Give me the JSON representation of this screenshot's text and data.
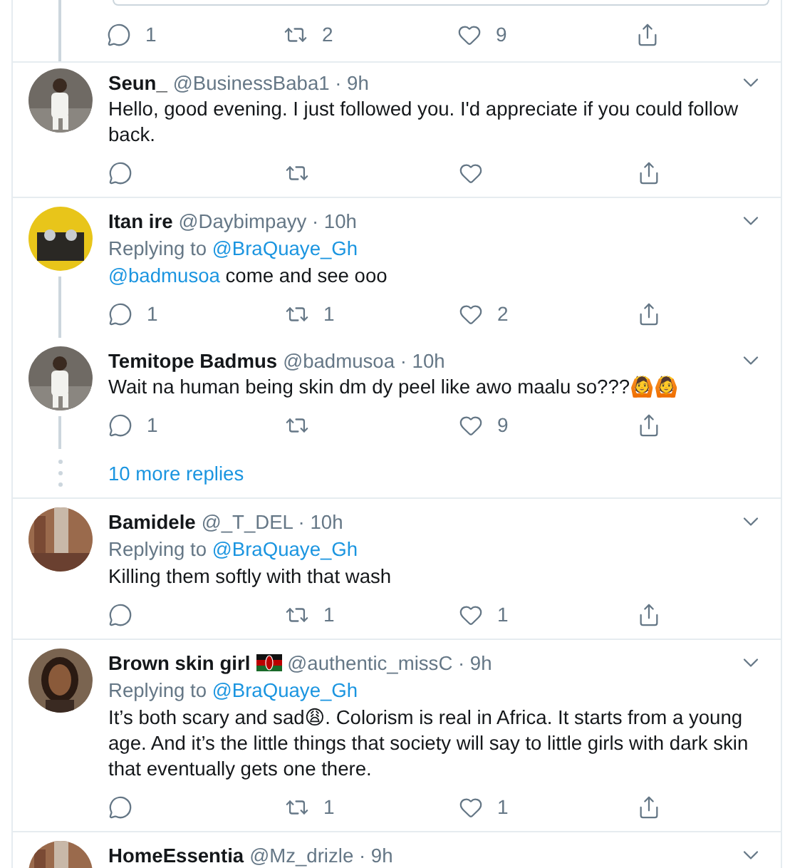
{
  "top_actions": {
    "reply": "1",
    "retweet": "2",
    "like": "9"
  },
  "groups": [
    {
      "tweets": [
        {
          "name": "Seun_",
          "meta": "@BusinessBaba1 · 9h",
          "text": "Hello, good evening. I just followed you. I'd appreciate if you could follow back."
        }
      ]
    },
    {
      "tweets": [
        {
          "name": "Itan ire",
          "meta": "@Daybimpayy · 10h",
          "replying_label": "Replying to",
          "replying_handle": "@BraQuaye_Gh",
          "mention": "@badmusoa",
          "text": "come and see ooo",
          "actions": {
            "reply": "1",
            "retweet": "1",
            "like": "2"
          }
        },
        {
          "name": "Temitope Badmus",
          "meta": "@badmusoa · 10h",
          "text": "Wait na human being skin dm dy peel like awo maalu so???🙆🙆",
          "actions": {
            "reply": "1",
            "like": "9"
          }
        }
      ],
      "more_replies": "10 more replies"
    },
    {
      "tweets": [
        {
          "name": "Bamidele",
          "meta": "@_T_DEL · 10h",
          "replying_label": "Replying to",
          "replying_handle": "@BraQuaye_Gh",
          "text": "Killing them softly with that wash",
          "actions": {
            "retweet": "1",
            "like": "1"
          }
        }
      ]
    },
    {
      "tweets": [
        {
          "name": "Brown skin girl",
          "flag": true,
          "meta": "@authentic_missC · 9h",
          "replying_label": "Replying to",
          "replying_handle": "@BraQuaye_Gh",
          "text": "It’s both scary and sad😩. Colorism is real in Africa. It starts from a young age. And it’s the little things that society will say to little girls with dark skin that eventually gets one there.",
          "actions": {
            "retweet": "1",
            "like": "1"
          }
        }
      ]
    },
    {
      "tweets": [
        {
          "name": "HomeEssentia",
          "meta": "@Mz_drizle · 9h"
        }
      ]
    }
  ]
}
